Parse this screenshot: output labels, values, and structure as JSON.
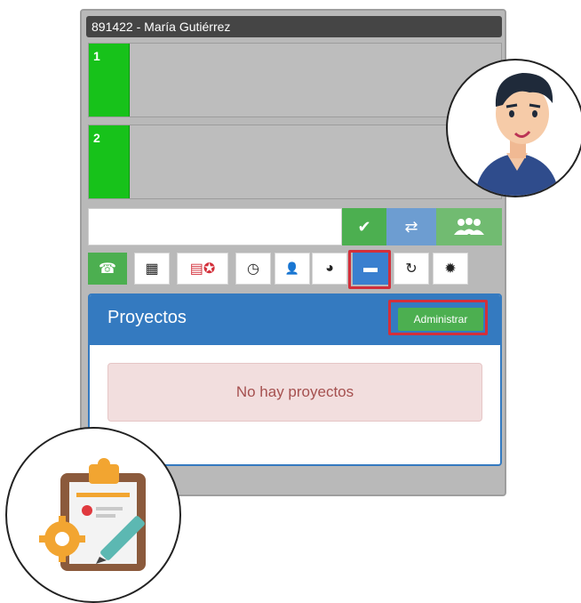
{
  "header": {
    "title": "891422 - María Gutiérrez"
  },
  "lines": [
    {
      "number": "1"
    },
    {
      "number": "2"
    }
  ],
  "action_row": {
    "dial_value": "",
    "ok_icon": "check-icon",
    "transfer_icon": "transfer-arrows-icon",
    "conference_icon": "group-icon"
  },
  "toolbar": {
    "items": [
      {
        "icon": "phone-icon",
        "glyph": "☎"
      },
      {
        "icon": "keypad-icon",
        "glyph": "▦"
      },
      {
        "icon": "calendar-star-icon",
        "glyph": "▤✪"
      },
      {
        "icon": "clock-icon",
        "glyph": "◷"
      },
      {
        "icon": "user-icon",
        "glyph": "👤"
      },
      {
        "icon": "globe-icon",
        "glyph": "◕"
      },
      {
        "icon": "chat-icon",
        "glyph": "▬"
      },
      {
        "icon": "refresh-icon",
        "glyph": "↻"
      },
      {
        "icon": "gear-icon",
        "glyph": "✹"
      }
    ]
  },
  "projects": {
    "title": "Proyectos",
    "admin_label": "Administrar",
    "empty_message": "No hay proyectos"
  },
  "colors": {
    "green": "#4caf50",
    "line_green": "#17c21a",
    "blue": "#347ac0",
    "highlight_red": "#d32f3a",
    "alert_bg": "#f2dede"
  }
}
